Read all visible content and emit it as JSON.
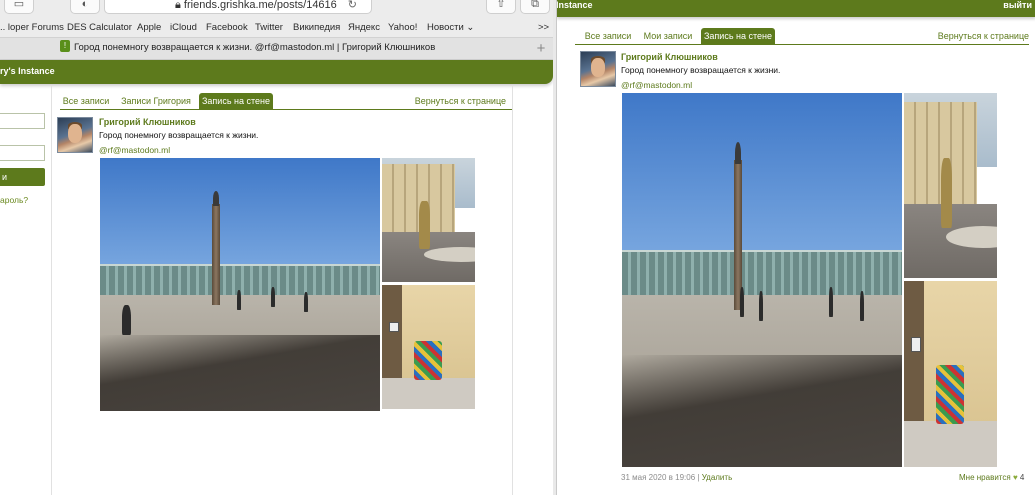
{
  "browser": {
    "url": "friends.grishka.me/posts/14616",
    "bookmarks": [
      ".. loper Forums",
      "DES Calculator",
      "Apple",
      "iCloud",
      "Facebook",
      "Twitter",
      "Википедия",
      "Яндекс",
      "Yahoo!",
      "Новости ⌄"
    ],
    "bookmarks_more": ">>",
    "tab_title": "Город понемногу возвращается к жизни. @rf@mastodon.ml | Григорий Клюшников",
    "new_tab": "+"
  },
  "left_page": {
    "banner_title": "ry's Instance",
    "sidebar": {
      "login_button": "и",
      "forgot_link": "ароль?"
    },
    "tabs": [
      "Все записи",
      "Записи Григория",
      "Запись на стене"
    ],
    "active_tab": 2,
    "back_link": "Вернуться к странице",
    "post": {
      "author": "Григорий Клюшников",
      "text": "Город понемногу возвращается к жизни.",
      "mention": "@rf@mastodon.ml"
    }
  },
  "right_page": {
    "banner_title": "Instance",
    "logout": "выйти",
    "tabs": [
      "Все записи",
      "Мои записи",
      "Запись на стене"
    ],
    "active_tab": 2,
    "back_link": "Вернуться к странице",
    "post": {
      "author": "Григорий Клюшников",
      "text": "Город понемногу возвращается к жизни.",
      "mention": "@rf@mastodon.ml",
      "date": "31 мая 2020 в 19:06",
      "separator": "|",
      "delete": "Удалить",
      "like_label": "Мне нравится",
      "like_count": "4"
    }
  },
  "colors": {
    "brand_green": "#5d7a1c",
    "link_green": "#6b8a20"
  }
}
